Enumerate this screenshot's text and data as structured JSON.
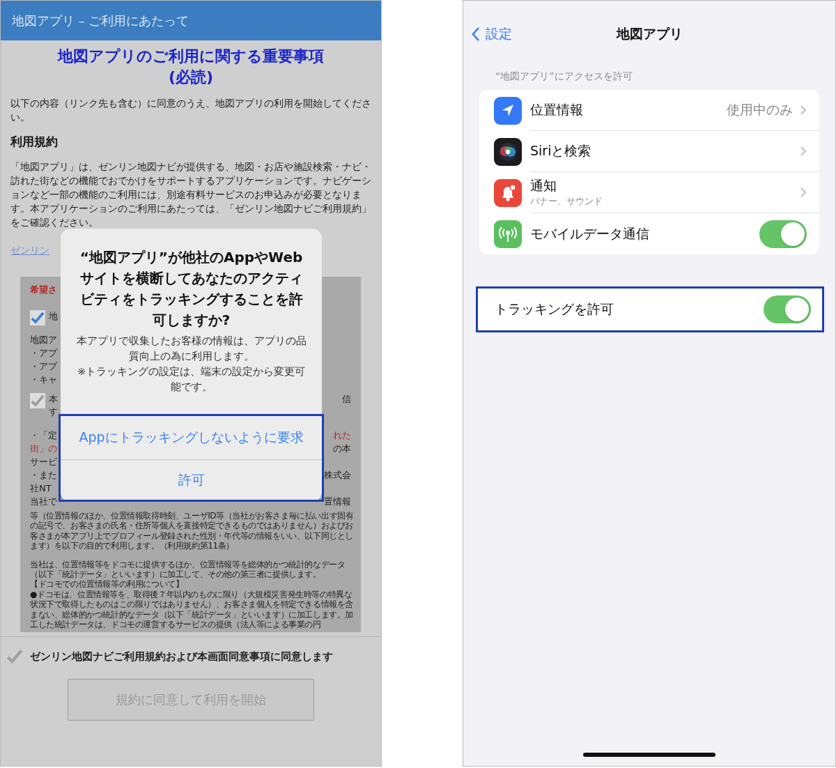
{
  "left_screen": {
    "header": {
      "title": "地図アプリ – ご利用にあたって"
    },
    "title_lines": [
      "地図アプリのご利用に関する重要事項",
      "(必読)"
    ],
    "intro": "以下の内容（リンク先も含む）に同意のうえ、地図アプリの利用を開始してください。",
    "terms_heading": "利用規約",
    "terms_text": "「地図アプリ」は、ゼンリン地図ナビが提供する、地図・お店や施設検索・ナビ・訪れた街などの機能でおでかけをサポートするアプリケーションです。ナビゲーションなど一部の機能のご利用には、別途有料サービスのお申込みが必要となります。本アプリケーションのご利用にあたっては、「ゼンリン地図ナビご利用規約」をご確認ください。",
    "terms_link": "ゼンリン",
    "consent_panel": {
      "rows": [
        {
          "kind": "heading",
          "left": "希望さ",
          "left_red": true
        },
        {
          "kind": "checkbox",
          "left": "地",
          "checked": true,
          "disabled": false
        },
        {
          "kind": "text",
          "left": "地図ア",
          "left_red": false
        },
        {
          "kind": "text",
          "left": "・アプ",
          "left_red": false
        },
        {
          "kind": "text",
          "left": "・アプ",
          "left_red": false
        },
        {
          "kind": "text",
          "left": "・キャ",
          "left_red": false
        },
        {
          "kind": "checkbox",
          "left": "本",
          "second": "す",
          "right": "信",
          "checked": true,
          "disabled": true
        },
        {
          "kind": "text",
          "left": "・「定",
          "right": "れた",
          "left_red": false,
          "right_red": true
        },
        {
          "kind": "text",
          "left": "街」の",
          "right": "の本",
          "left_red": true,
          "right_red": false
        },
        {
          "kind": "text",
          "left": "サービ",
          "left_red": false
        },
        {
          "kind": "text",
          "left": "・また",
          "right": "株式会",
          "left_red": false,
          "right_red": false
        },
        {
          "kind": "text",
          "left": "社NT",
          "left_red": false
        },
        {
          "kind": "text",
          "left": "当社で",
          "right": "置情報",
          "left_red": false,
          "right_red": false
        }
      ],
      "blocks": [
        [
          "等（位置情報のほか、位置情報取得時刻、ユーザID等（当社がお客さま毎に払い出す固有の記号で、お客さまの氏名・住所等個人を直接特定できるものではありません）およびお客さまが本アプリ上でプロフィール登録された性別・年代等の情報をいい、以下同じとします）を以下の目的で利用します。（利用規約第11条）"
        ],
        [
          "当社は、位置情報等をドコモに提供するほか、位置情報等を総体的かつ統計的なデータ（以下「統計データ」といいます）に加工して、その他の第三者に提供します。",
          "【ドコモでの位置情報等の利用について】",
          "●ドコモは、位置情報等を、取得後７年以内のものに限り（大規模災害発生時等の特異な状況下で取得したものはこの限りではありません）、お客さま個人を特定できる情報を含まない、総体的かつ統計的なデータ（以下「統計データ」といいます）に加工します。加工した統計データは、ドコモの運営するサービスの提供（法人等による事業の円"
        ]
      ]
    },
    "agree": {
      "label": "ゼンリン地図ナビご利用規約および本画面同意事項に同意します",
      "checked": false
    },
    "start_button": {
      "label": "規約に同意して利用を開始",
      "disabled": true
    },
    "dialog": {
      "title": "“地図アプリ”が他社のAppやWebサイトを横断してあなたのアクティビティをトラッキングすることを許可しますか?",
      "message": [
        "本アプリで収集したお客様の情報は、アプリの品質向上の為に利用します。",
        "※トラッキングの設定は、端末の設定から変更可能です。"
      ],
      "actions_highlighted": true,
      "actions": [
        "Appにトラッキングしないように要求",
        "許可"
      ]
    }
  },
  "right_screen": {
    "nav": {
      "back": "設定",
      "title": "地図アプリ"
    },
    "section_header": "“地図アプリ”にアクセスを許可",
    "rows": [
      {
        "label": "位置情報",
        "kind": "link",
        "value": "使用中のみ"
      },
      {
        "label": "Siriと検索",
        "kind": "link"
      },
      {
        "label": "通知",
        "kind": "link",
        "subtitle": "バナー、サウンド"
      },
      {
        "label": "モバイルデータ通信",
        "kind": "toggle",
        "on": true
      }
    ],
    "tracking": {
      "label": "トラッキングを許可",
      "on": true,
      "highlighted": true
    }
  }
}
